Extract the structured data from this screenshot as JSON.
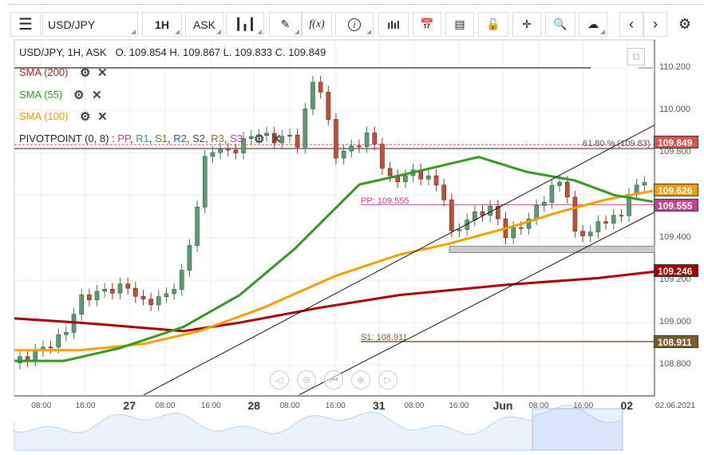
{
  "toolbar": {
    "symbol": "USD/JPY",
    "timeframe": "1H",
    "price_type": "ASK",
    "fx_label": "f(x)"
  },
  "header": {
    "info": "USD/JPY, 1H, ASK",
    "ohlc": "O. 109.854 H. 109.867 L. 109.833 C. 109.849"
  },
  "indicators": [
    {
      "label": "SMA (200)",
      "color": "#b22222"
    },
    {
      "label": "SMA (55)",
      "color": "#339922"
    },
    {
      "label": "SMA (100)",
      "color": "#ff9900"
    }
  ],
  "pivot": {
    "label": "PIVOTPOINT (0, 8)",
    "sep": " : ",
    "items": [
      {
        "t": "PP",
        "c": "#cc33aa"
      },
      {
        "t": "R1",
        "c": "#22aa66"
      },
      {
        "t": "S1",
        "c": "#8a6a2a"
      },
      {
        "t": "R2",
        "c": "#2255cc"
      },
      {
        "t": "S2",
        "c": "#444444"
      },
      {
        "t": "R3",
        "c": "#8a6a2a"
      },
      {
        "t": "S3",
        "c": "#cc33cc"
      }
    ]
  },
  "annotations": {
    "fib": "61.80 % (109.83)",
    "pp": "PP: 109.555",
    "s1": "S1: 108.911"
  },
  "price_labels": [
    {
      "v": "109.849",
      "c": "#d9534f",
      "p": 109.849
    },
    {
      "v": "109.626",
      "c": "#f39c12",
      "p": 109.626
    },
    {
      "v": "109.555",
      "c": "#c0448f",
      "p": 109.555
    },
    {
      "v": "109.246",
      "c": "#a50000",
      "p": 109.246
    },
    {
      "v": "108.911",
      "c": "#7a5c2e",
      "p": 108.911
    }
  ],
  "yticks": [
    "110.200",
    "110.000",
    "109.800",
    "109.400",
    "109.200",
    "109.000",
    "108.800"
  ],
  "xticks": [
    {
      "t": "08:00",
      "h": 4.9
    },
    {
      "t": "16:00",
      "h": 12.9
    },
    {
      "t": "27",
      "h": 20.9,
      "big": true
    },
    {
      "t": "08:00",
      "h": 27.4
    },
    {
      "t": "16:00",
      "h": 35.7
    },
    {
      "t": "28",
      "h": 43.5,
      "big": true
    },
    {
      "t": "08:00",
      "h": 50
    },
    {
      "t": "16:00",
      "h": 58.3
    },
    {
      "t": "31",
      "h": 66.2,
      "big": true
    },
    {
      "t": "08:00",
      "h": 72.6
    },
    {
      "t": "16:00",
      "h": 80.7
    },
    {
      "t": "Jun",
      "h": 88.7,
      "big": true
    },
    {
      "t": "08:00",
      "h": 95.2
    },
    {
      "t": "16:00",
      "h": 103.3
    },
    {
      "t": "02",
      "h": 111.2,
      "big": true
    }
  ],
  "date_label": "02.06.2021",
  "chart_data": {
    "type": "candlestick",
    "ylim": [
      108.66,
      110.32
    ],
    "price_path": [
      [
        0,
        108.81
      ],
      [
        4.6,
        108.87
      ],
      [
        9,
        108.94
      ],
      [
        11.9,
        109.11
      ],
      [
        16.2,
        109.15
      ],
      [
        20.6,
        109.17
      ],
      [
        23.5,
        109.09
      ],
      [
        27.8,
        109.13
      ],
      [
        30.7,
        109.24
      ],
      [
        32.9,
        109.5
      ],
      [
        34.3,
        109.75
      ],
      [
        35.8,
        109.82
      ],
      [
        39.4,
        109.8
      ],
      [
        43.8,
        109.9
      ],
      [
        46.7,
        109.86
      ],
      [
        49.6,
        109.88
      ],
      [
        51.7,
        109.84
      ],
      [
        53.9,
        110.14
      ],
      [
        55.4,
        110.12
      ],
      [
        56.8,
        109.96
      ],
      [
        58.3,
        109.79
      ],
      [
        61.2,
        109.82
      ],
      [
        64.1,
        109.88
      ],
      [
        65.5,
        109.84
      ],
      [
        67.7,
        109.67
      ],
      [
        69.9,
        109.68
      ],
      [
        72.8,
        109.71
      ],
      [
        75.7,
        109.67
      ],
      [
        77.8,
        109.62
      ],
      [
        79.3,
        109.41
      ],
      [
        81.4,
        109.47
      ],
      [
        84.3,
        109.52
      ],
      [
        87.2,
        109.54
      ],
      [
        88.7,
        109.41
      ],
      [
        90.9,
        109.43
      ],
      [
        93.8,
        109.5
      ],
      [
        97.4,
        109.63
      ],
      [
        99.6,
        109.67
      ],
      [
        101,
        109.56
      ],
      [
        101.7,
        109.41
      ],
      [
        104.6,
        109.43
      ],
      [
        107.5,
        109.49
      ],
      [
        110.4,
        109.5
      ],
      [
        111.2,
        109.62
      ],
      [
        113.3,
        109.63
      ],
      [
        115.5,
        109.71
      ]
    ],
    "sma200": [
      [
        0,
        109.02
      ],
      [
        11.9,
        109.0
      ],
      [
        30.7,
        108.96
      ],
      [
        40.9,
        109.0
      ],
      [
        55.4,
        109.07
      ],
      [
        69.9,
        109.13
      ],
      [
        90.1,
        109.18
      ],
      [
        106,
        109.21
      ],
      [
        116.2,
        109.24
      ]
    ],
    "sma55": [
      [
        0,
        108.82
      ],
      [
        9,
        108.82
      ],
      [
        19.1,
        108.88
      ],
      [
        30.7,
        108.98
      ],
      [
        40.9,
        109.13
      ],
      [
        51,
        109.35
      ],
      [
        62.6,
        109.65
      ],
      [
        72.8,
        109.71
      ],
      [
        84.3,
        109.78
      ],
      [
        93,
        109.71
      ],
      [
        101.7,
        109.67
      ],
      [
        109,
        109.6
      ],
      [
        115.9,
        109.57
      ]
    ],
    "sma100": [
      [
        0,
        108.87
      ],
      [
        11.9,
        108.87
      ],
      [
        23.5,
        108.9
      ],
      [
        33.6,
        108.96
      ],
      [
        45.2,
        109.07
      ],
      [
        58.3,
        109.22
      ],
      [
        69.9,
        109.32
      ],
      [
        78.6,
        109.37
      ],
      [
        90.1,
        109.45
      ],
      [
        98.8,
        109.52
      ],
      [
        107.5,
        109.58
      ],
      [
        115.9,
        109.62
      ]
    ],
    "channel_upper": [
      [
        23.5,
        108.66
      ],
      [
        116.2,
        109.93
      ]
    ],
    "channel_lower": [
      [
        51.7,
        108.66
      ],
      [
        116.2,
        109.52
      ]
    ],
    "hline_top": 110.2,
    "fib_level": 109.838,
    "fib_gray": 109.82,
    "pp": 109.555,
    "s1": 108.911,
    "support_zone": [
      109.33,
      109.36
    ]
  }
}
